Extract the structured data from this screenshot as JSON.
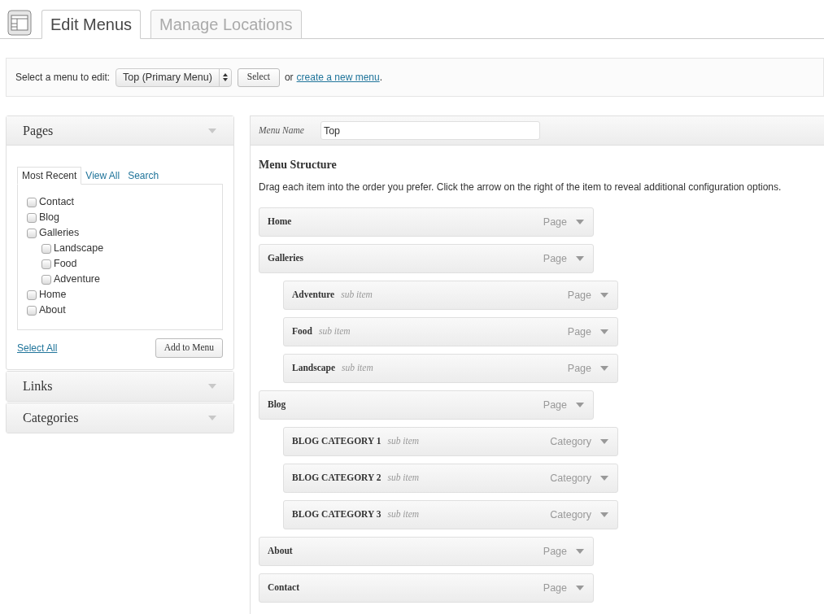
{
  "tabs": [
    {
      "label": "Edit Menus",
      "selected": true
    },
    {
      "label": "Manage Locations",
      "selected": false
    }
  ],
  "select_bar": {
    "label": "Select a menu to edit:",
    "dropdown": "Top (Primary Menu)",
    "button": "Select",
    "or_text": "or",
    "link": "create a new menu",
    "after_link": "."
  },
  "sidebar": [
    {
      "title": "Pages",
      "expanded": true,
      "tabs": [
        {
          "label": "Most Recent",
          "selected": true
        },
        {
          "label": "View All",
          "selected": false
        },
        {
          "label": "Search",
          "selected": false
        }
      ],
      "items": [
        {
          "label": "Contact",
          "checked": false
        },
        {
          "label": "Blog",
          "checked": false
        },
        {
          "label": "Galleries",
          "checked": false,
          "children": [
            {
              "label": "Landscape",
              "checked": false
            },
            {
              "label": "Food",
              "checked": false
            },
            {
              "label": "Adventure",
              "checked": false
            }
          ]
        },
        {
          "label": "Home",
          "checked": false
        },
        {
          "label": "About",
          "checked": false
        }
      ],
      "select_all": "Select All",
      "add_button": "Add to Menu"
    },
    {
      "title": "Links",
      "expanded": false
    },
    {
      "title": "Categories",
      "expanded": false
    }
  ],
  "menu_editor": {
    "name_label": "Menu Name",
    "name_value": "Top",
    "heading": "Menu Structure",
    "instructions": "Drag each item into the order you prefer. Click the arrow on the right of the item to reveal additional configuration options.",
    "items": [
      {
        "title": "Home",
        "type": "Page"
      },
      {
        "title": "Galleries",
        "type": "Page",
        "children": [
          {
            "title": "Adventure",
            "note": "sub item",
            "type": "Page"
          },
          {
            "title": "Food",
            "note": "sub item",
            "type": "Page"
          },
          {
            "title": "Landscape",
            "note": "sub item",
            "type": "Page"
          }
        ]
      },
      {
        "title": "Blog",
        "type": "Page",
        "children": [
          {
            "title": "BLOG CATEGORY 1",
            "note": "sub item",
            "type": "Category"
          },
          {
            "title": "BLOG CATEGORY 2",
            "note": "sub item",
            "type": "Category"
          },
          {
            "title": "BLOG CATEGORY 3",
            "note": "sub item",
            "type": "Category"
          }
        ]
      },
      {
        "title": "About",
        "type": "Page"
      },
      {
        "title": "Contact",
        "type": "Page"
      }
    ]
  }
}
